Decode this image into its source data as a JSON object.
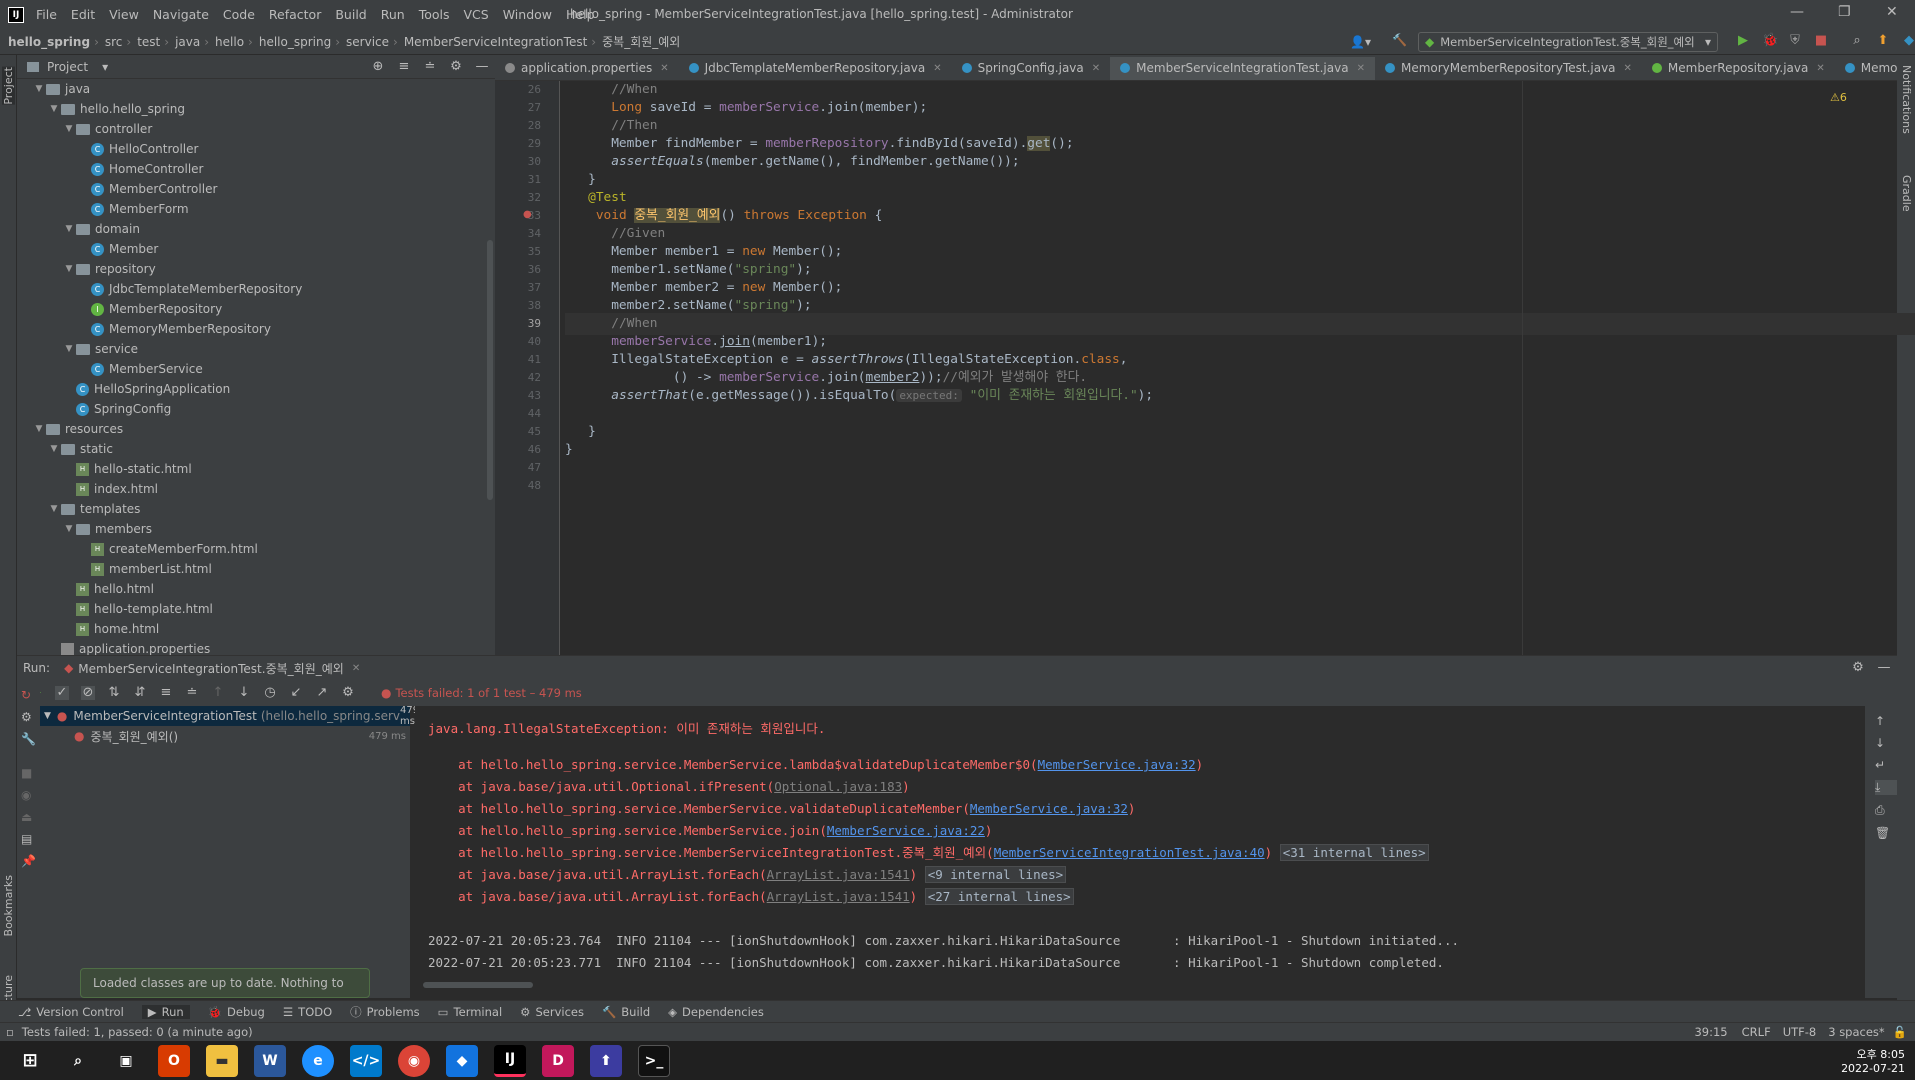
{
  "menu": [
    "File",
    "Edit",
    "View",
    "Navigate",
    "Code",
    "Refactor",
    "Build",
    "Run",
    "Tools",
    "VCS",
    "Window",
    "Help"
  ],
  "window_title": "hello_spring - MemberServiceIntegrationTest.java [hello_spring.test] - Administrator",
  "breadcrumb": [
    "hello_spring",
    "src",
    "test",
    "java",
    "hello",
    "hello_spring",
    "service",
    "MemberServiceIntegrationTest",
    "중복_회원_예외"
  ],
  "run_config": "MemberServiceIntegrationTest.중복_회원_예외",
  "project": {
    "title": "Project",
    "tree": [
      {
        "l": "java",
        "d": 3,
        "t": "folder",
        "o": true
      },
      {
        "l": "hello.hello_spring",
        "d": 4,
        "t": "folder",
        "o": true
      },
      {
        "l": "controller",
        "d": 5,
        "t": "folder",
        "o": true
      },
      {
        "l": "HelloController",
        "d": 6,
        "t": "class"
      },
      {
        "l": "HomeController",
        "d": 6,
        "t": "class"
      },
      {
        "l": "MemberController",
        "d": 6,
        "t": "class"
      },
      {
        "l": "MemberForm",
        "d": 6,
        "t": "class"
      },
      {
        "l": "domain",
        "d": 5,
        "t": "folder",
        "o": true
      },
      {
        "l": "Member",
        "d": 6,
        "t": "class"
      },
      {
        "l": "repository",
        "d": 5,
        "t": "folder",
        "o": true
      },
      {
        "l": "JdbcTemplateMemberRepository",
        "d": 6,
        "t": "class"
      },
      {
        "l": "MemberRepository",
        "d": 6,
        "t": "iface"
      },
      {
        "l": "MemoryMemberRepository",
        "d": 6,
        "t": "class"
      },
      {
        "l": "service",
        "d": 5,
        "t": "folder",
        "o": true
      },
      {
        "l": "MemberService",
        "d": 6,
        "t": "class"
      },
      {
        "l": "HelloSpringApplication",
        "d": 5,
        "t": "class"
      },
      {
        "l": "SpringConfig",
        "d": 5,
        "t": "class"
      },
      {
        "l": "resources",
        "d": 3,
        "t": "folder",
        "o": true
      },
      {
        "l": "static",
        "d": 4,
        "t": "folder",
        "o": true
      },
      {
        "l": "hello-static.html",
        "d": 5,
        "t": "html"
      },
      {
        "l": "index.html",
        "d": 5,
        "t": "html"
      },
      {
        "l": "templates",
        "d": 4,
        "t": "folder",
        "o": true
      },
      {
        "l": "members",
        "d": 5,
        "t": "folder",
        "o": true
      },
      {
        "l": "createMemberForm.html",
        "d": 6,
        "t": "html"
      },
      {
        "l": "memberList.html",
        "d": 6,
        "t": "html"
      },
      {
        "l": "hello.html",
        "d": 5,
        "t": "html"
      },
      {
        "l": "hello-template.html",
        "d": 5,
        "t": "html"
      },
      {
        "l": "home.html",
        "d": 5,
        "t": "html"
      },
      {
        "l": "application.properties",
        "d": 4,
        "t": "prop"
      }
    ]
  },
  "tabs": [
    {
      "label": "application.properties",
      "c": "#8a8a8a"
    },
    {
      "label": "JdbcTemplateMemberRepository.java",
      "c": "#3592c4"
    },
    {
      "label": "SpringConfig.java",
      "c": "#3592c4"
    },
    {
      "label": "MemberServiceIntegrationTest.java",
      "c": "#3592c4",
      "active": true
    },
    {
      "label": "MemoryMemberRepositoryTest.java",
      "c": "#3592c4"
    },
    {
      "label": "MemberRepository.java",
      "c": "#62b543"
    },
    {
      "label": "MemoryMemberRep",
      "c": "#3592c4"
    }
  ],
  "warnings": "⚠6",
  "line_numbers": [
    "26",
    "27",
    "28",
    "29",
    "30",
    "31",
    "32",
    "33",
    "34",
    "35",
    "36",
    "37",
    "38",
    "39",
    "40",
    "41",
    "42",
    "43",
    "44",
    "45",
    "46",
    "47",
    "48"
  ],
  "run": {
    "title": "Run:",
    "tab": "MemberServiceIntegrationTest.중복_회원_예외",
    "result": "Tests failed: 1 of 1 test – 479 ms",
    "tree_root": "MemberServiceIntegrationTest",
    "tree_root_pkg": "(hello.hello_spring.serv",
    "tree_root_time": "479 ms",
    "tree_child": "중복_회원_예외()",
    "tree_child_time": "479 ms"
  },
  "console": {
    "exception": "java.lang.IllegalStateException: 이미 존재하는 회원입니다.",
    "log1": "2022-07-21 20:05:23.764  INFO 21104 --- [ionShutdownHook] com.zaxxer.hikari.HikariDataSource       : HikariPool-1 - Shutdown initiated...",
    "log2": "2022-07-21 20:05:23.771  INFO 21104 --- [ionShutdownHook] com.zaxxer.hikari.HikariDataSource       : HikariPool-1 - Shutdown completed."
  },
  "toast": "Loaded classes are up to date. Nothing to reload.",
  "bottom_tabs": [
    "Version Control",
    "Run",
    "Debug",
    "TODO",
    "Problems",
    "Terminal",
    "Services",
    "Build",
    "Dependencies"
  ],
  "status": {
    "left": "Tests failed: 1, passed: 0 (a minute ago)",
    "pos": "39:15",
    "eol": "CRLF",
    "enc": "UTF-8",
    "indent": "3 spaces*"
  },
  "clock": {
    "time": "오후 8:05",
    "date": "2022-07-21"
  },
  "side": {
    "project": "Project",
    "bookmarks": "Bookmarks",
    "structure": "Structure",
    "notifications": "Notifications",
    "gradle": "Gradle"
  }
}
